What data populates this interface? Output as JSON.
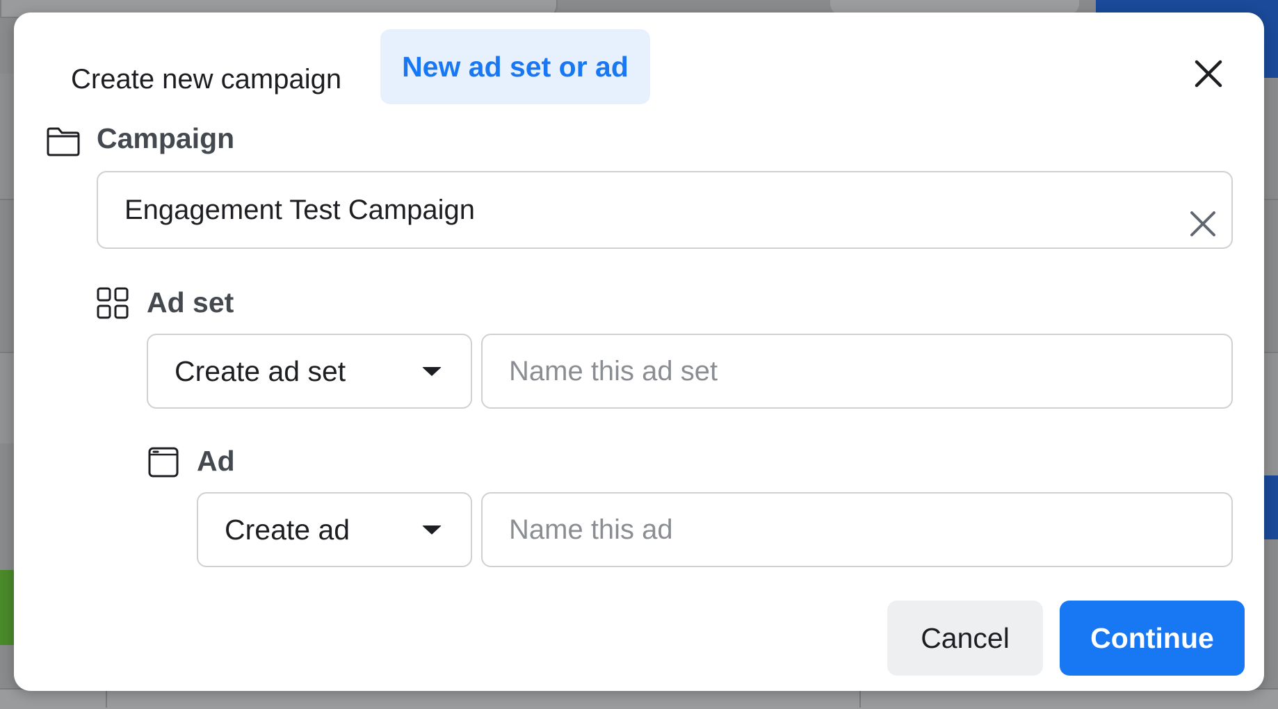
{
  "tabs": {
    "create_new_campaign": "Create new campaign",
    "new_ad_set_or_ad": "New ad set or ad"
  },
  "campaign": {
    "label": "Campaign",
    "value": "Engagement Test Campaign"
  },
  "ad_set": {
    "label": "Ad set",
    "dropdown_value": "Create ad set",
    "name_placeholder": "Name this ad set"
  },
  "ad": {
    "label": "Ad",
    "dropdown_value": "Create ad",
    "name_placeholder": "Name this ad"
  },
  "footer": {
    "cancel_label": "Cancel",
    "continue_label": "Continue"
  },
  "icons": {
    "close": "close-icon",
    "campaign": "folder-icon",
    "ad_set": "grid-icon",
    "ad": "window-icon",
    "dropdown": "caret-down-icon",
    "clear": "clear-icon"
  },
  "colors": {
    "accent": "#1877f2",
    "active_tab_bg": "#e7f0fd",
    "cancel_bg": "#eeeff1"
  }
}
